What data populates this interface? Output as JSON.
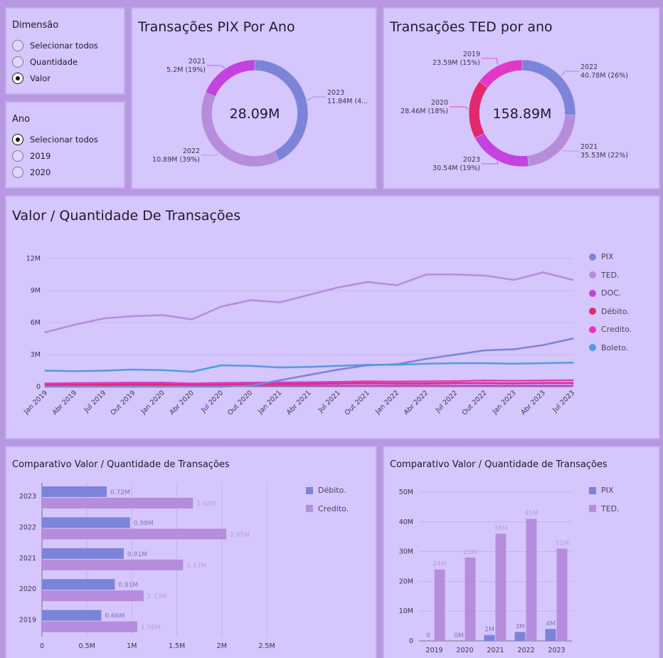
{
  "filters": {
    "dimensao": {
      "title": "Dimensão",
      "options": [
        "Selecionar todos",
        "Quantidade",
        "Valor"
      ],
      "selected": 2
    },
    "ano": {
      "title": "Ano",
      "options": [
        "Selecionar todos",
        "2019",
        "2020"
      ],
      "selected": 0
    }
  },
  "pix_donut": {
    "title": "Transações PIX Por Ano",
    "center": "28.09M",
    "labels": [
      {
        "year": "2021",
        "value": "5.2M (19%)"
      },
      {
        "year": "2023",
        "value": "11.84M (4..."
      },
      {
        "year": "2022",
        "value": "10.89M (39%)"
      }
    ]
  },
  "ted_donut": {
    "title": "Transações TED por ano",
    "center": "158.89M",
    "labels": [
      {
        "year": "2019",
        "value": "23.59M (15%)"
      },
      {
        "year": "2022",
        "value": "40.78M (26%)"
      },
      {
        "year": "2020",
        "value": "28.46M (18%)"
      },
      {
        "year": "2021",
        "value": "35.53M (22%)"
      },
      {
        "year": "2023",
        "value": "30.54M (19%)"
      }
    ]
  },
  "line_panel": {
    "title": "Valor / Quantidade De Transações"
  },
  "bar_h_panel": {
    "title": "Comparativo Valor / Quantidade de Transações"
  },
  "bar_v_panel": {
    "title": "Comparativo Valor / Quantidade de Transações"
  },
  "colors": {
    "pix": "#7b84d9",
    "ted": "#b58ddc",
    "doc": "#c342e0",
    "debito": "#e4286e",
    "credito": "#e138c8",
    "boleto": "#519be0"
  },
  "chart_data": [
    {
      "type": "pie",
      "title": "Transações PIX Por Ano",
      "categories": [
        "2021",
        "2022",
        "2023"
      ],
      "values": [
        5.2,
        10.89,
        11.84
      ],
      "unit": "M",
      "total_label": "28.09M"
    },
    {
      "type": "pie",
      "title": "Transações TED por ano",
      "categories": [
        "2019",
        "2020",
        "2021",
        "2022",
        "2023"
      ],
      "values": [
        23.59,
        28.46,
        35.53,
        40.78,
        30.54
      ],
      "unit": "M",
      "total_label": "158.89M"
    },
    {
      "type": "line",
      "title": "Valor / Quantidade De Transações",
      "x": [
        "Jan 2019",
        "Abr 2019",
        "Jul 2019",
        "Out 2019",
        "Jan 2020",
        "Abr 2020",
        "Jul 2020",
        "Out 2020",
        "Jan 2021",
        "Abr 2021",
        "Jul 2021",
        "Out 2021",
        "Jan 2022",
        "Abr 2022",
        "Jul 2022",
        "Out 2022",
        "Jan 2023",
        "Abr 2023",
        "Jul 2023"
      ],
      "y_ticks": [
        "0",
        "3M",
        "6M",
        "9M",
        "12M"
      ],
      "ylim": [
        0,
        12
      ],
      "legend_position": "right",
      "series": [
        {
          "name": "PIX",
          "values": [
            0,
            0,
            0,
            0,
            0,
            0,
            0,
            0.1,
            0.6,
            1.1,
            1.6,
            2.0,
            2.1,
            2.6,
            3.0,
            3.4,
            3.5,
            3.9,
            4.5
          ]
        },
        {
          "name": "TED.",
          "values": [
            5.1,
            5.8,
            6.4,
            6.6,
            6.7,
            6.3,
            7.5,
            8.1,
            7.9,
            8.6,
            9.3,
            9.8,
            9.5,
            10.5,
            10.5,
            10.4,
            10.0,
            10.7,
            10.0
          ]
        },
        {
          "name": "DOC.",
          "values": [
            0.15,
            0.15,
            0.15,
            0.15,
            0.15,
            0.15,
            0.15,
            0.12,
            0.12,
            0.12,
            0.1,
            0.1,
            0.1,
            0.1,
            0.1,
            0.1,
            0.1,
            0.1,
            0.1
          ]
        },
        {
          "name": "Débito.",
          "values": [
            0.2,
            0.22,
            0.22,
            0.24,
            0.22,
            0.2,
            0.25,
            0.27,
            0.28,
            0.28,
            0.3,
            0.32,
            0.3,
            0.3,
            0.33,
            0.33,
            0.32,
            0.34,
            0.34
          ]
        },
        {
          "name": "Credito.",
          "values": [
            0.3,
            0.33,
            0.35,
            0.38,
            0.38,
            0.3,
            0.35,
            0.38,
            0.4,
            0.42,
            0.45,
            0.5,
            0.48,
            0.5,
            0.52,
            0.58,
            0.55,
            0.58,
            0.6
          ]
        },
        {
          "name": "Boleto.",
          "values": [
            1.5,
            1.45,
            1.5,
            1.6,
            1.55,
            1.4,
            2.0,
            1.95,
            1.8,
            1.85,
            1.95,
            2.05,
            2.05,
            2.15,
            2.2,
            2.2,
            2.15,
            2.2,
            2.25
          ]
        }
      ]
    },
    {
      "type": "bar",
      "orientation": "horizontal",
      "title": "Comparativo Valor / Quantidade de Transações",
      "categories": [
        "2023",
        "2022",
        "2021",
        "2020",
        "2019"
      ],
      "x_ticks": [
        "0",
        "0.5M",
        "1M",
        "1.5M",
        "2M",
        "2.5M"
      ],
      "xlim": [
        0,
        2.5
      ],
      "series": [
        {
          "name": "Débito.",
          "values": [
            0.72,
            0.98,
            0.91,
            0.81,
            0.66
          ],
          "labels": [
            "0.72M",
            "0.98M",
            "0.91M",
            "0.81M",
            "0.66M"
          ]
        },
        {
          "name": "Credito.",
          "values": [
            1.68,
            2.05,
            1.57,
            1.13,
            1.06
          ],
          "labels": [
            "1.68M",
            "2.05M",
            "1.57M",
            "1.13M",
            "1.06M"
          ]
        }
      ]
    },
    {
      "type": "bar",
      "orientation": "vertical",
      "title": "Comparativo Valor / Quantidade de Transações",
      "categories": [
        "2019",
        "2020",
        "2021",
        "2022",
        "2023"
      ],
      "y_ticks": [
        "0",
        "10M",
        "20M",
        "30M",
        "40M",
        "50M"
      ],
      "ylim": [
        0,
        50
      ],
      "series": [
        {
          "name": "PIX",
          "values": [
            0,
            0,
            2,
            3,
            4
          ],
          "labels": [
            "0",
            "0M",
            "2M",
            "3M",
            "4M"
          ]
        },
        {
          "name": "TED.",
          "values": [
            24,
            28,
            36,
            41,
            31
          ],
          "labels": [
            "24M",
            "28M",
            "36M",
            "41M",
            "31M"
          ]
        }
      ]
    }
  ]
}
